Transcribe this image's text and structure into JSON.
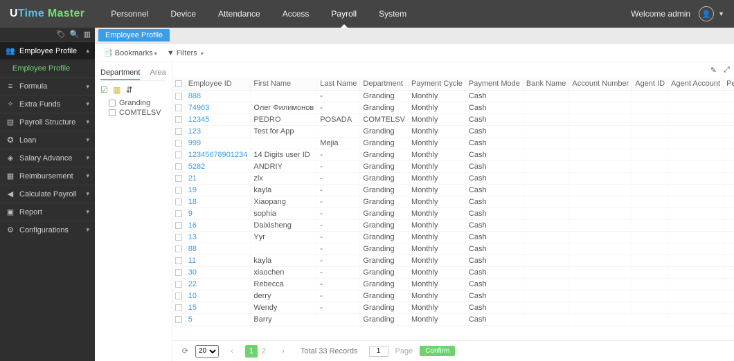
{
  "brand": {
    "u": "U",
    "time": "Time",
    "space": " ",
    "master": "Master"
  },
  "mainmenu": [
    "Personnel",
    "Device",
    "Attendance",
    "Access",
    "Payroll",
    "System"
  ],
  "mainmenu_active": 4,
  "welcome": "Welcome admin",
  "sidebar_groups": [
    {
      "icon": "👥",
      "label": "Employee Profile",
      "expanded": true,
      "children": [
        "Employee Profile"
      ]
    },
    {
      "icon": "≡",
      "label": "Formula"
    },
    {
      "icon": "✧",
      "label": "Extra Funds"
    },
    {
      "icon": "▤",
      "label": "Payroll Structure"
    },
    {
      "icon": "✪",
      "label": "Loan"
    },
    {
      "icon": "◈",
      "label": "Salary Advance"
    },
    {
      "icon": "▦",
      "label": "Reimbursement"
    },
    {
      "icon": "◀",
      "label": "Calculate Payroll"
    },
    {
      "icon": "▣",
      "label": "Report"
    },
    {
      "icon": "⚙",
      "label": "Configurations"
    }
  ],
  "tab_label": "Employee Profile",
  "toolbar": {
    "bookmarks": "Bookmarks",
    "filters": "Filters"
  },
  "tree_tabs": [
    "Department",
    "Area"
  ],
  "tree_tabs_active": 0,
  "tree_nodes": [
    "Granding",
    "COMTELSV"
  ],
  "columns": [
    "Employee ID",
    "First Name",
    "Last Name",
    "Department",
    "Payment Cycle",
    "Payment Mode",
    "Bank Name",
    "Account Number",
    "Agent ID",
    "Agent Account",
    "Personnel ID"
  ],
  "rows": [
    {
      "emp": "888",
      "first": "",
      "last": "-",
      "dept": "Granding",
      "cycle": "Monthly",
      "mode": "Cash"
    },
    {
      "emp": "74963",
      "first": "Олег Филимонов",
      "last": "-",
      "dept": "Granding",
      "cycle": "Monthly",
      "mode": "Cash"
    },
    {
      "emp": "12345",
      "first": "PEDRO",
      "last": "POSADA",
      "dept": "COMTELSV",
      "cycle": "Monthly",
      "mode": "Cash"
    },
    {
      "emp": "123",
      "first": "Test for App",
      "last": "",
      "dept": "Granding",
      "cycle": "Monthly",
      "mode": "Cash"
    },
    {
      "emp": "999",
      "first": "",
      "last": "Mejia",
      "dept": "Granding",
      "cycle": "Monthly",
      "mode": "Cash"
    },
    {
      "emp": "12345678901234",
      "first": "14 Digits user ID",
      "last": "-",
      "dept": "Granding",
      "cycle": "Monthly",
      "mode": "Cash"
    },
    {
      "emp": "5282",
      "first": "ANDRIY",
      "last": "-",
      "dept": "Granding",
      "cycle": "Monthly",
      "mode": "Cash"
    },
    {
      "emp": "21",
      "first": "zlx",
      "last": "-",
      "dept": "Granding",
      "cycle": "Monthly",
      "mode": "Cash"
    },
    {
      "emp": "19",
      "first": "kayla",
      "last": "-",
      "dept": "Granding",
      "cycle": "Monthly",
      "mode": "Cash"
    },
    {
      "emp": "18",
      "first": "Xiaopang",
      "last": "-",
      "dept": "Granding",
      "cycle": "Monthly",
      "mode": "Cash"
    },
    {
      "emp": "9",
      "first": "sophia",
      "last": "-",
      "dept": "Granding",
      "cycle": "Monthly",
      "mode": "Cash"
    },
    {
      "emp": "16",
      "first": "Daixisheng",
      "last": "-",
      "dept": "Granding",
      "cycle": "Monthly",
      "mode": "Cash"
    },
    {
      "emp": "13",
      "first": "Yyr",
      "last": "-",
      "dept": "Granding",
      "cycle": "Monthly",
      "mode": "Cash"
    },
    {
      "emp": "88",
      "first": "",
      "last": "-",
      "dept": "Granding",
      "cycle": "Monthly",
      "mode": "Cash"
    },
    {
      "emp": "11",
      "first": "kayla",
      "last": "-",
      "dept": "Granding",
      "cycle": "Monthly",
      "mode": "Cash"
    },
    {
      "emp": "30",
      "first": "xiaochen",
      "last": "-",
      "dept": "Granding",
      "cycle": "Monthly",
      "mode": "Cash"
    },
    {
      "emp": "22",
      "first": "Rebecca",
      "last": "-",
      "dept": "Granding",
      "cycle": "Monthly",
      "mode": "Cash"
    },
    {
      "emp": "10",
      "first": "derry",
      "last": "-",
      "dept": "Granding",
      "cycle": "Monthly",
      "mode": "Cash"
    },
    {
      "emp": "15",
      "first": "Wendy",
      "last": "-",
      "dept": "Granding",
      "cycle": "Monthly",
      "mode": "Cash"
    },
    {
      "emp": "5",
      "first": "Barry",
      "last": "",
      "dept": "Granding",
      "cycle": "Monthly",
      "mode": "Cash"
    }
  ],
  "pager": {
    "pagesize": "20",
    "pages": [
      "1",
      "2"
    ],
    "active_page": 0,
    "total": "Total 33 Records",
    "page_input": "1",
    "page_label": "Page",
    "confirm": "Confirm"
  }
}
